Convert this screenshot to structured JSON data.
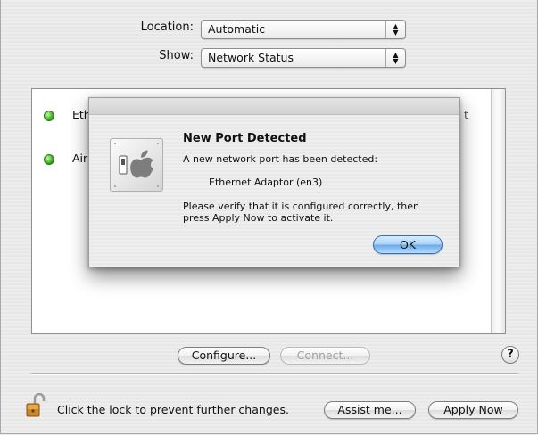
{
  "location": {
    "label": "Location:",
    "value": "Automatic"
  },
  "show": {
    "label": "Show:",
    "value": "Network Status"
  },
  "ports": [
    {
      "name": "Eth",
      "status_color": "#3caa1e"
    },
    {
      "name": "Airl",
      "status_color": "#3caa1e"
    }
  ],
  "list_right_fragment": "t",
  "buttons": {
    "configure": "Configure...",
    "connect": "Connect...",
    "help": "?",
    "assist": "Assist me...",
    "apply": "Apply Now"
  },
  "lock_text": "Click the lock to prevent further changes.",
  "dialog": {
    "title": "New Port Detected",
    "message": "A new network port has been detected:",
    "port_name": "Ethernet Adaptor (en3)",
    "instructions": "Please verify that it is configured correctly, then press Apply Now to activate it.",
    "ok": "OK"
  },
  "icons": {
    "lock": "padlock-open-icon",
    "sheet": "switch-plate-apple-icon",
    "popup_arrows": "updown-arrows-icon",
    "status_dot": "green-status-icon"
  }
}
